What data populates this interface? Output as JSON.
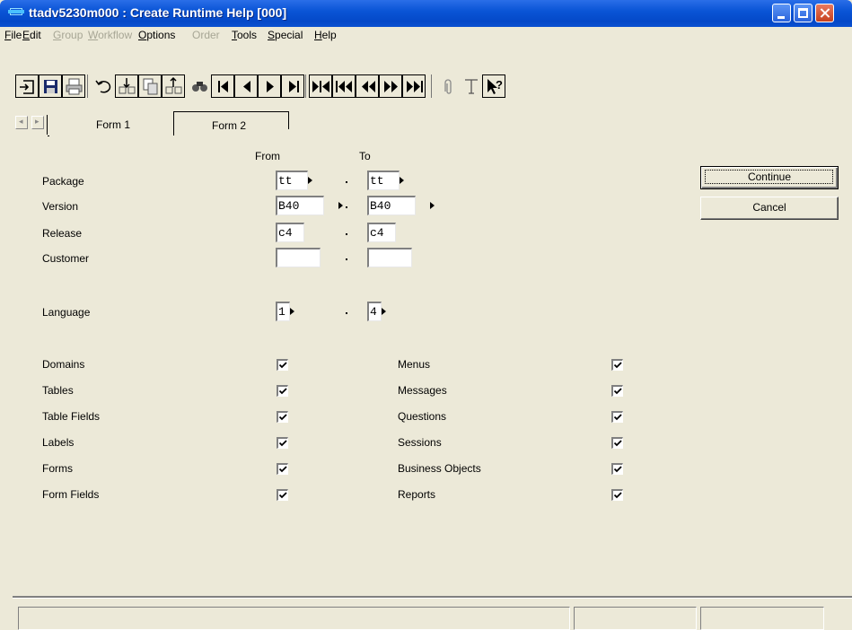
{
  "window": {
    "title": "ttadv5230m000 : Create Runtime Help [000]"
  },
  "menu": [
    {
      "u": "F",
      "rest": "ile",
      "enabled": true
    },
    {
      "u": "E",
      "rest": "dit",
      "enabled": true
    },
    {
      "u": "G",
      "rest": "roup",
      "enabled": false
    },
    {
      "u": "W",
      "rest": "orkflow",
      "enabled": false
    },
    {
      "u": "O",
      "rest": "ptions",
      "enabled": true
    },
    {
      "u": "",
      "rest": "Order",
      "enabled": false
    },
    {
      "u": "T",
      "rest": "ools",
      "enabled": true
    },
    {
      "u": "S",
      "rest": "pecial",
      "enabled": true
    },
    {
      "u": "H",
      "rest": "elp",
      "enabled": true
    }
  ],
  "tabs": [
    {
      "label": "Form 1",
      "active": true
    },
    {
      "label": "Form 2",
      "active": false
    }
  ],
  "range_headers": {
    "from": "From",
    "to": "To"
  },
  "range_fields": [
    {
      "label": "Package",
      "from": "tt",
      "to": "tt",
      "has_zoom": true
    },
    {
      "label": "Version",
      "from": "B40",
      "to": "B40",
      "has_zoom": true
    },
    {
      "label": "Release",
      "from": "c4",
      "to": "c4",
      "has_zoom": false
    },
    {
      "label": "Customer",
      "from": "",
      "to": "",
      "has_zoom": false
    },
    {
      "label": "Language",
      "from": "1",
      "to": "4",
      "has_zoom": true
    }
  ],
  "checkboxes_left": [
    {
      "label": "Domains",
      "checked": true
    },
    {
      "label": "Tables",
      "checked": true
    },
    {
      "label": "Table Fields",
      "checked": true
    },
    {
      "label": "Labels",
      "checked": true
    },
    {
      "label": "Forms",
      "checked": true
    },
    {
      "label": "Form Fields",
      "checked": true
    }
  ],
  "checkboxes_right": [
    {
      "label": "Menus",
      "checked": true
    },
    {
      "label": "Messages",
      "checked": true
    },
    {
      "label": "Questions",
      "checked": true
    },
    {
      "label": "Sessions",
      "checked": true
    },
    {
      "label": "Business Objects",
      "checked": true
    },
    {
      "label": "Reports",
      "checked": true
    }
  ],
  "buttons": {
    "continue": "Continue",
    "cancel": "Cancel"
  },
  "status": [
    "",
    "",
    ""
  ],
  "colors": {
    "titlebar": "#0a55d6",
    "window_bg": "#ece9d8",
    "close_button": "#c6401e"
  },
  "toolbar_icons": [
    "exit-icon",
    "save-icon",
    "print-icon",
    "undo-icon",
    "insert-record-icon",
    "copy-record-icon",
    "delete-record-icon",
    "find-icon",
    "first-record-icon",
    "previous-record-icon",
    "next-record-icon",
    "last-record-icon",
    "first-set-icon",
    "previous-set-icon",
    "previous-page-icon",
    "next-page-icon",
    "last-set-icon",
    "attachment-icon",
    "text-icon",
    "context-help-icon"
  ]
}
